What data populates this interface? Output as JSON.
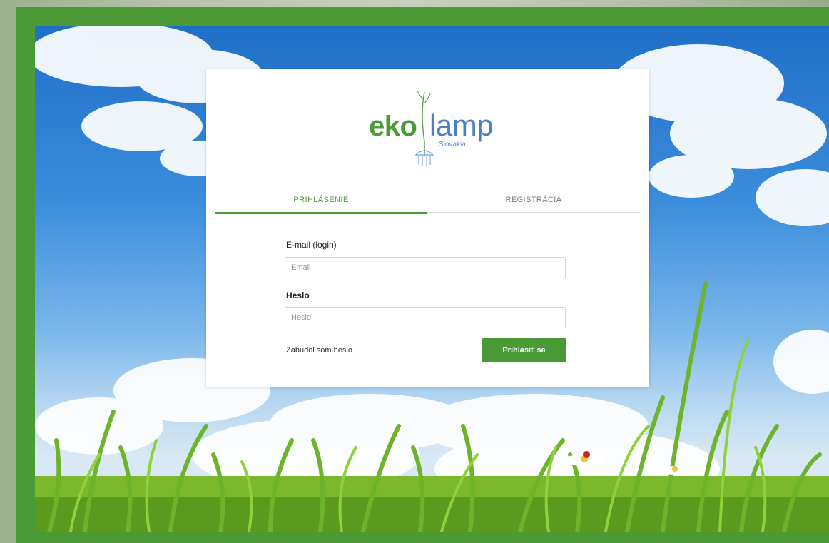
{
  "brand": {
    "name_part1": "eko",
    "name_part2": "lamp",
    "subtitle": "Slovakia"
  },
  "tabs": [
    {
      "label": "PRIHLÁSENIE",
      "active": true
    },
    {
      "label": "REGISTRÁCIA",
      "active": false
    }
  ],
  "form": {
    "email_label": "E-mail (login)",
    "email_placeholder": "Email",
    "email_value": "",
    "password_label": "Heslo",
    "password_placeholder": "Heslo",
    "password_value": "",
    "forgot_link": "Zabudol som heslo",
    "submit_label": "Prihlásiť sa"
  },
  "colors": {
    "accent": "#4a9a36",
    "lamp_blue": "#4a7fc0",
    "frame_green": "#4c9a35"
  },
  "icons": [
    "lamp-plant-icon"
  ]
}
